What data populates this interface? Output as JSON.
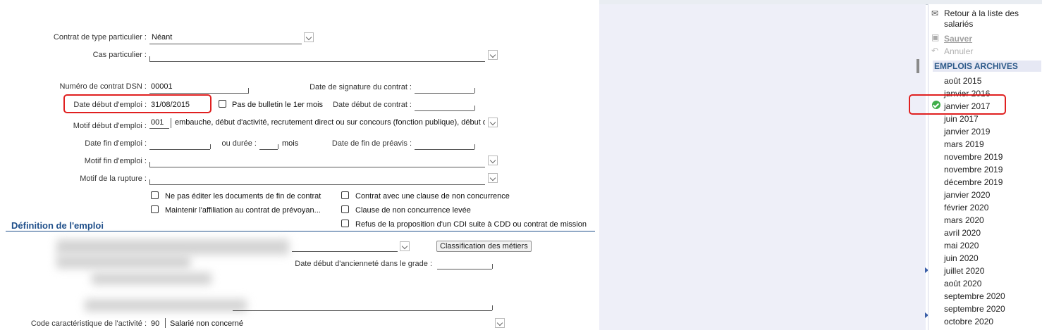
{
  "form": {
    "contrat_type_particulier": {
      "label": "Contrat de type particulier :",
      "value": "Néant"
    },
    "cas_particulier": {
      "label": "Cas particulier :",
      "value": ""
    },
    "numero_contrat_dsn": {
      "label": "Numéro de contrat DSN :",
      "value": "00001"
    },
    "date_signature_contrat": {
      "label": "Date de signature du contrat :",
      "value": ""
    },
    "date_debut_emploi": {
      "label": "Date début d'emploi :",
      "value": "31/08/2015"
    },
    "pas_bulletin": {
      "label": "Pas de bulletin le 1er mois"
    },
    "date_debut_contrat": {
      "label": "Date début de contrat :",
      "value": ""
    },
    "motif_debut_emploi": {
      "label": "Motif début d'emploi :",
      "code": "001",
      "value": "embauche, début d'activité, recrutement direct ou sur concours (fonction publique), début de c"
    },
    "date_fin_emploi": {
      "label": "Date fin d'emploi :",
      "value": ""
    },
    "ou_duree": {
      "label": "ou durée :",
      "value": "",
      "unit": "mois"
    },
    "date_fin_preavis": {
      "label": "Date de fin de préavis :",
      "value": ""
    },
    "motif_fin_emploi": {
      "label": "Motif fin d'emploi :",
      "value": ""
    },
    "motif_rupture": {
      "label": "Motif de la rupture :",
      "value": ""
    },
    "checkboxes_left": [
      "Ne pas éditer les documents de fin de contrat",
      "Maintenir l'affiliation au contrat de prévoyan..."
    ],
    "checkboxes_right": [
      "Contrat avec une clause de non concurrence",
      "Clause de non concurrence levée",
      "Refus de la proposition d'un CDI suite à CDD ou contrat de mission"
    ],
    "section_title": "Définition de l'emploi",
    "classification_button": "Classification des métiers",
    "date_anciennete_grade": {
      "label": "Date début d'ancienneté dans le grade :",
      "value": ""
    },
    "code_activite": {
      "label": "Code caractéristique de l'activité :",
      "code": "90",
      "value": "Salarié non concerné"
    }
  },
  "sidebar": {
    "retour": "Retour à la liste des salariés",
    "sauver": "Sauver",
    "annuler": "Annuler",
    "heading": "EMPLOIS ARCHIVES",
    "selected_index": 2,
    "accent_color": "#3fae49",
    "emplois": [
      "août 2015",
      "janvier 2016",
      "janvier 2017",
      "juin 2017",
      "janvier 2019",
      "mars 2019",
      "novembre 2019",
      "novembre 2019",
      "décembre 2019",
      "janvier 2020",
      "février 2020",
      "mars 2020",
      "avril 2020",
      "mai 2020",
      "juin 2020",
      "juillet 2020",
      "août 2020",
      "septembre 2020",
      "septembre 2020",
      "octobre 2020"
    ]
  }
}
